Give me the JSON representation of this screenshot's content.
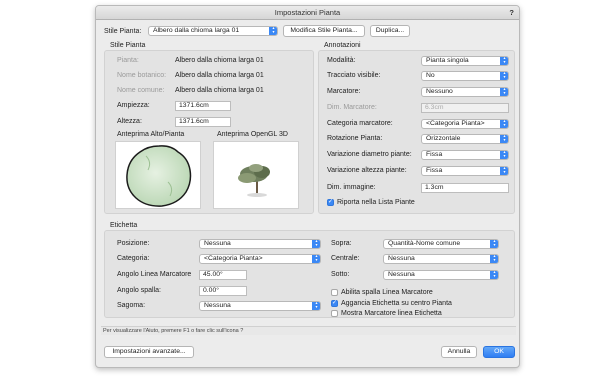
{
  "dialog": {
    "title": "Impostazioni Pianta",
    "help": "?"
  },
  "top": {
    "style_label": "Stile Pianta:",
    "style_value": "Albero dalla chioma larga 01",
    "edit_button": "Modifica Stile Pianta...",
    "duplicate_button": "Duplica..."
  },
  "plant_style": {
    "title": "Stile Pianta",
    "plant_label": "Pianta:",
    "plant_value": "Albero dalla chioma larga 01",
    "botanic_label": "Nome botanico:",
    "botanic_value": "Albero dalla chioma larga 01",
    "common_label": "Nome comune:",
    "common_value": "Albero dalla chioma larga 01",
    "width_label": "Ampiezza:",
    "width_value": "1371.6cm",
    "height_label": "Altezza:",
    "height_value": "1371.6cm",
    "preview_top_label": "Anteprima Alto/Pianta",
    "preview_3d_label": "Anteprima OpenGL 3D"
  },
  "annotations": {
    "title": "Annotazioni",
    "modality_label": "Modalità:",
    "modality_value": "Pianta singola",
    "trace_label": "Tracciato visibile:",
    "trace_value": "No",
    "marker_label": "Marcatore:",
    "marker_value": "Nessuno",
    "marker_dim_label": "Dim. Marcatore:",
    "marker_dim_value": "6.3cm",
    "marker_cat_label": "Categoria marcatore:",
    "marker_cat_value": "<Categoria Pianta>",
    "rotation_label": "Rotazione Pianta:",
    "rotation_value": "Orizzontale",
    "diam_var_label": "Variazione diametro piante:",
    "diam_var_value": "Fissa",
    "height_var_label": "Variazione altezza piante:",
    "height_var_value": "Fissa",
    "image_dim_label": "Dim. immagine:",
    "image_dim_value": "1.3cm",
    "report_label": "Riporta nella Lista Piante"
  },
  "label_group": {
    "title": "Etichetta",
    "position_label": "Posizione:",
    "position_value": "Nessuna",
    "category_label": "Categoria:",
    "category_value": "<Categoria Pianta>",
    "angle_label": "Angolo Linea Marcatore",
    "angle_value": "45.00°",
    "shoulder_label": "Angolo spalla:",
    "shoulder_value": "0.00°",
    "shape_label": "Sagoma:",
    "shape_value": "Nessuna",
    "above_label": "Sopra:",
    "above_value": "Quantità-Nome comune",
    "center_label": "Centrale:",
    "center_value": "Nessuna",
    "below_label": "Sotto:",
    "below_value": "Nessuna",
    "cb_shoulder": "Abilita spalla Linea Marcatore",
    "cb_attach": "Aggancia Etichetta su centro Pianta",
    "cb_show_marker": "Mostra Marcatore linea Etichetta"
  },
  "status_text": "Per visualizzare l'Aiuto, premere F1 o fare clic sull'icona ?",
  "footer": {
    "advanced_button": "Impostazioni avanzate...",
    "cancel_button": "Annulla",
    "ok_button": "OK"
  },
  "colors": {
    "accent": "#3b88f5",
    "tree_fill": "#c5dfc0"
  }
}
